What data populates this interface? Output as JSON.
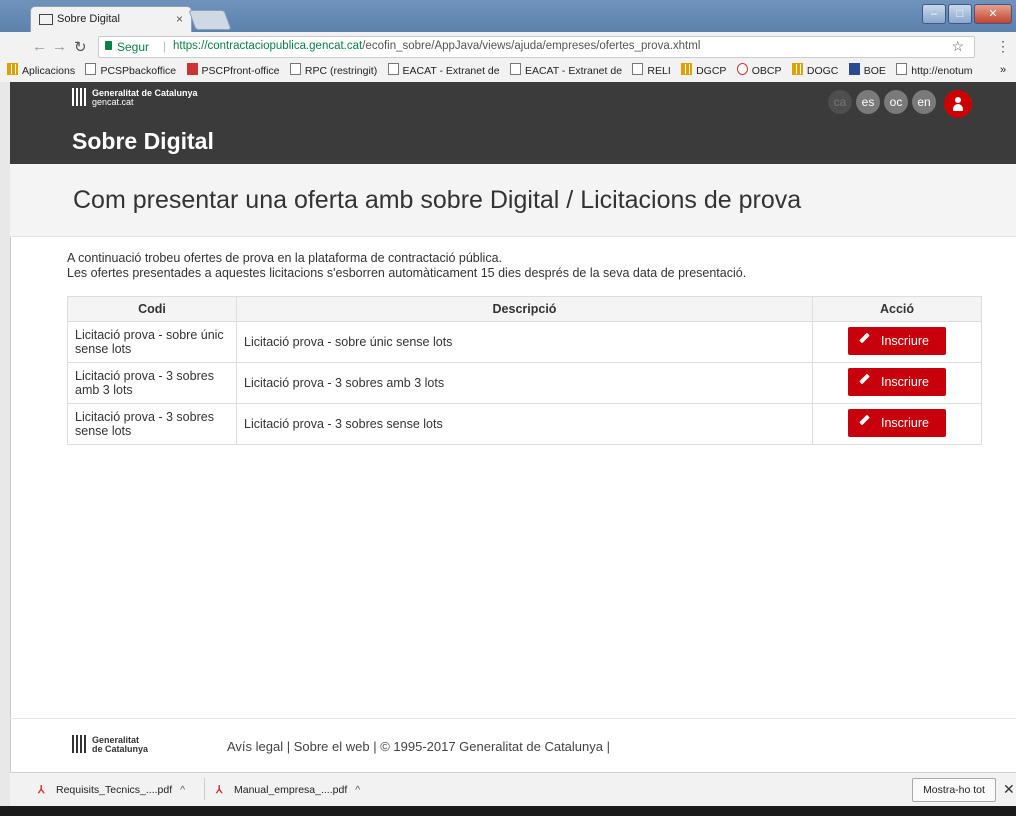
{
  "browser": {
    "tab_title": "Sobre Digital",
    "tab_close": "×",
    "secure_label": "Segur",
    "url_host": "https://contractaciopublica.gencat.cat",
    "url_path": "/ecofin_sobre/AppJava/views/ajuda/empreses/ofertes_prova.xhtml",
    "bookmarks": [
      "Aplicacions",
      "PCSPbackoffice",
      "PSCPfront-office",
      "RPC (restringit)",
      "EACAT - Extranet de",
      "EACAT - Extranet de",
      "RELI",
      "DGCP",
      "OBCP",
      "DOGC",
      "BOE",
      "http://enotum"
    ],
    "more": "»"
  },
  "header": {
    "org_line1": "Generalitat de Catalunya",
    "org_line2": "gencat.cat",
    "site_title": "Sobre Digital",
    "languages": [
      "ca",
      "es",
      "oc",
      "en"
    ]
  },
  "page": {
    "title": "Com presentar una oferta amb sobre Digital / Licitacions de prova",
    "intro1": "A continuació trobeu ofertes de prova en la plataforma de contractació pública.",
    "intro2": "Les ofertes presentades a aquestes licitacions s'esborren automàticament 15 dies després de la seva data de presentació."
  },
  "table": {
    "headers": {
      "code": "Codi",
      "description": "Descripció",
      "action": "Acció"
    },
    "rows": [
      {
        "code": "Licitació prova - sobre únic sense lots",
        "description": "Licitació prova - sobre únic sense lots",
        "action": "Inscriure"
      },
      {
        "code": "Licitació prova - 3 sobres amb 3 lots",
        "description": "Licitació prova - 3 sobres amb 3 lots",
        "action": "Inscriure"
      },
      {
        "code": "Licitació prova - 3 sobres sense lots",
        "description": "Licitació prova - 3 sobres sense lots",
        "action": "Inscriure"
      }
    ]
  },
  "footer": {
    "org_line1": "Generalitat",
    "org_line2": "de Catalunya",
    "text": "Avís legal | Sobre el web | © 1995-2017 Generalitat de Catalunya |"
  },
  "downloads": {
    "files": [
      "Requisits_Tecnics_....pdf",
      "Manual_empresa_....pdf"
    ],
    "show_all": "Mostra-ho tot"
  }
}
